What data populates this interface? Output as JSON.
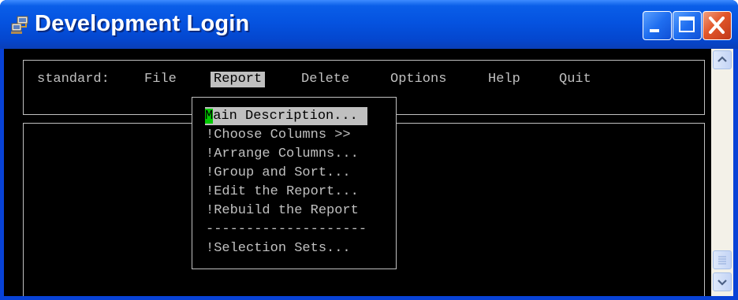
{
  "window": {
    "title": "Development Login"
  },
  "menubar": {
    "prefix": "standard:",
    "items": [
      {
        "label": "File"
      },
      {
        "label": "Report"
      },
      {
        "label": "Delete"
      },
      {
        "label": "Options"
      },
      {
        "label": "Help"
      },
      {
        "label": "Quit"
      }
    ],
    "selected": "Report"
  },
  "dropdown": {
    "highlighted_cursor_char": "M",
    "highlighted_rest": "ain Description...",
    "items": [
      {
        "label": "!Choose Columns >>"
      },
      {
        "label": "!Arrange Columns..."
      },
      {
        "label": "!Group and Sort..."
      },
      {
        "label": "!Edit the Report..."
      },
      {
        "label": "!Rebuild the Report"
      },
      {
        "label": "--------------------"
      },
      {
        "label": "!Selection Sets..."
      }
    ]
  },
  "icons": {
    "app": "app-login-icon",
    "minimize": "minimize-icon",
    "maximize": "maximize-icon",
    "close": "close-icon",
    "scroll_up": "chevron-up-icon",
    "scroll_down": "chevron-down-icon",
    "scroll_thumb": "grip-icon"
  },
  "colors": {
    "title_blue": "#0553e0",
    "close_red": "#e2562a",
    "terminal_bg": "#000000",
    "terminal_fg": "#c0c0c0",
    "cursor_green": "#00c800"
  }
}
